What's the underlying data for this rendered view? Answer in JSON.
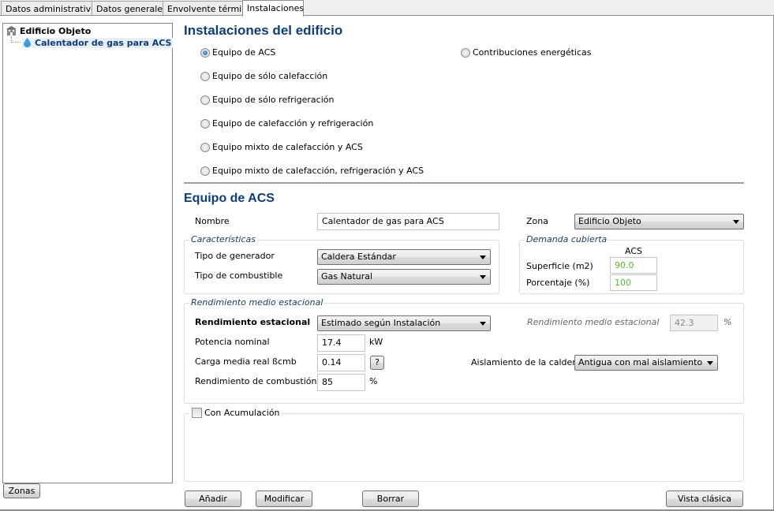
{
  "tabs": [
    {
      "label": "Datos administrativos",
      "active": false
    },
    {
      "label": "Datos generales",
      "active": false
    },
    {
      "label": "Envolvente térmica",
      "active": false
    },
    {
      "label": "Instalaciones",
      "active": true
    }
  ],
  "tree": {
    "root": {
      "label": "Edificio Objeto",
      "icon": "building-icon"
    },
    "children": [
      {
        "label": "Calentador de gas para ACS",
        "icon": "water-drop-icon",
        "selected": true
      }
    ]
  },
  "zonas_button": "Zonas",
  "main": {
    "title": "Instalaciones del edificio",
    "install_types": [
      {
        "label": "Equipo de ACS",
        "selected": true
      },
      {
        "label": "Equipo de sólo calefacción",
        "selected": false
      },
      {
        "label": "Equipo de sólo refrigeración",
        "selected": false
      },
      {
        "label": "Equipo de calefacción y refrigeración",
        "selected": false
      },
      {
        "label": "Equipo mixto de calefacción y ACS",
        "selected": false
      },
      {
        "label": "Equipo mixto de calefacción, refrigeración y ACS",
        "selected": false
      },
      {
        "label": "Contribuciones energéticas",
        "selected": false
      }
    ],
    "section_title": "Equipo de ACS",
    "nombre_label": "Nombre",
    "nombre_value": "Calentador de gas para ACS",
    "zona_label": "Zona",
    "zona_value": "Edificio Objeto",
    "caracteristicas": {
      "legend": "Características",
      "generador_label": "Tipo de generador",
      "generador_value": "Caldera Estándar",
      "combustible_label": "Tipo de combustible",
      "combustible_value": "Gas Natural"
    },
    "demanda": {
      "legend": "Demanda cubierta",
      "column": "ACS",
      "superficie_label": "Superficie (m2)",
      "superficie_value": "90.0",
      "porcentaje_label": "Porcentaje (%)",
      "porcentaje_value": "100"
    },
    "rendimiento": {
      "legend": "Rendimiento medio estacional",
      "estacional_label": "Rendimiento estacional",
      "estacional_value": "Estimado según Instalación",
      "medio_label": "Rendimiento medio estacional",
      "medio_value": "42.3",
      "medio_unit": "%",
      "potencia_label": "Potencia nominal",
      "potencia_value": "17.4",
      "potencia_unit": "kW",
      "carga_label": "Carga media real ßcmb",
      "carga_value": "0.14",
      "help_label": "?",
      "aislamiento_label": "Aislamiento de la caldera",
      "aislamiento_value": "Antigua con mal aislamiento",
      "combustion_label": "Rendimiento de combustión",
      "combustion_value": "85",
      "combustion_unit": "%"
    },
    "acumulacion": {
      "label": "Con Acumulación",
      "checked": false
    },
    "buttons": {
      "anadir": "Añadir",
      "modificar": "Modificar",
      "borrar": "Borrar",
      "vista_clasica": "Vista clásica"
    }
  }
}
